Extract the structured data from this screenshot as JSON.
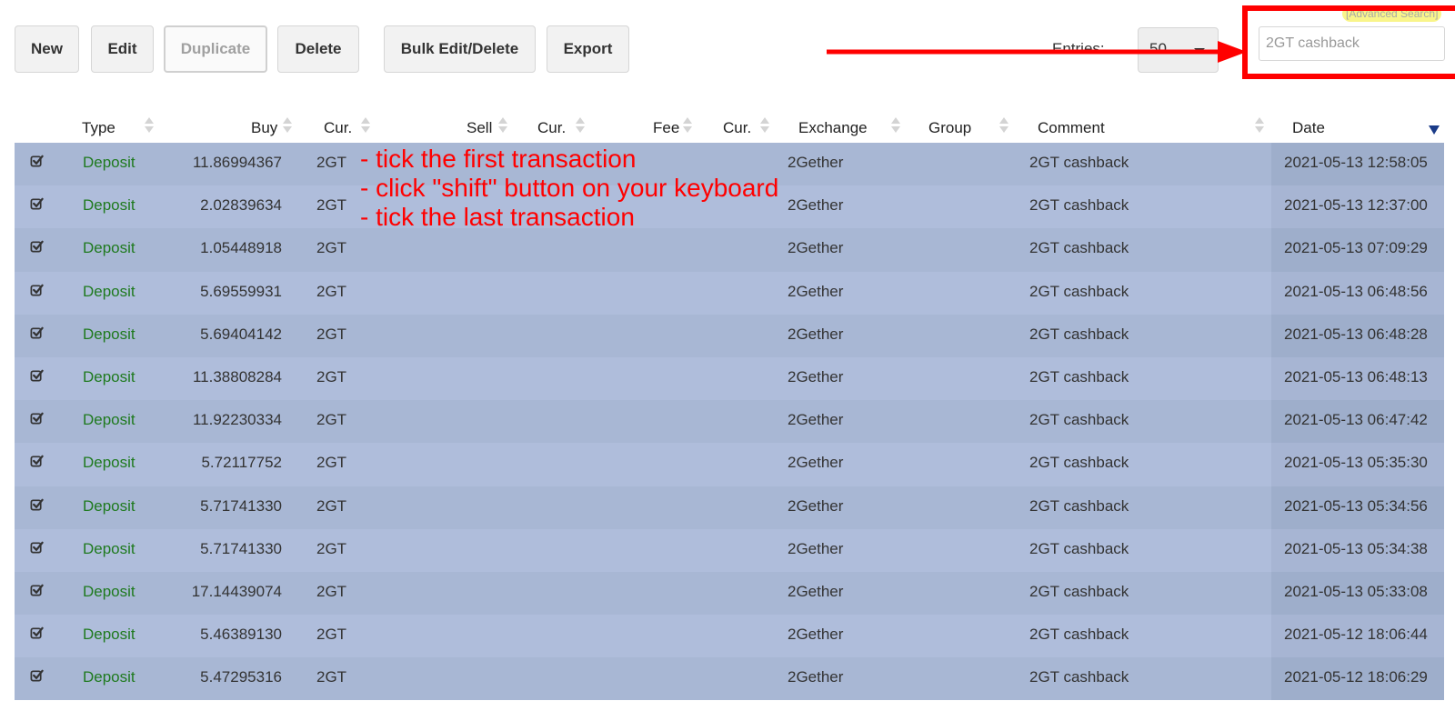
{
  "toolbar": {
    "new_label": "New",
    "edit_label": "Edit",
    "duplicate_label": "Duplicate",
    "delete_label": "Delete",
    "bulk_label": "Bulk Edit/Delete",
    "export_label": "Export",
    "entries_label": "Entries:",
    "entries_value": "50",
    "advanced_search": "[Advanced Search]",
    "search_placeholder": "2GT cashback"
  },
  "columns": {
    "type": "Type",
    "buy": "Buy",
    "buy_cur": "Cur.",
    "sell": "Sell",
    "sell_cur": "Cur.",
    "fee": "Fee",
    "fee_cur": "Cur.",
    "exchange": "Exchange",
    "group": "Group",
    "comment": "Comment",
    "date": "Date"
  },
  "rows": [
    {
      "type": "Deposit",
      "buy": "11.86994367",
      "cur": "2GT",
      "exchange": "2Gether",
      "comment": "2GT cashback",
      "date": "2021-05-13 12:58:05"
    },
    {
      "type": "Deposit",
      "buy": "2.02839634",
      "cur": "2GT",
      "exchange": "2Gether",
      "comment": "2GT cashback",
      "date": "2021-05-13 12:37:00"
    },
    {
      "type": "Deposit",
      "buy": "1.05448918",
      "cur": "2GT",
      "exchange": "2Gether",
      "comment": "2GT cashback",
      "date": "2021-05-13 07:09:29"
    },
    {
      "type": "Deposit",
      "buy": "5.69559931",
      "cur": "2GT",
      "exchange": "2Gether",
      "comment": "2GT cashback",
      "date": "2021-05-13 06:48:56"
    },
    {
      "type": "Deposit",
      "buy": "5.69404142",
      "cur": "2GT",
      "exchange": "2Gether",
      "comment": "2GT cashback",
      "date": "2021-05-13 06:48:28"
    },
    {
      "type": "Deposit",
      "buy": "11.38808284",
      "cur": "2GT",
      "exchange": "2Gether",
      "comment": "2GT cashback",
      "date": "2021-05-13 06:48:13"
    },
    {
      "type": "Deposit",
      "buy": "11.92230334",
      "cur": "2GT",
      "exchange": "2Gether",
      "comment": "2GT cashback",
      "date": "2021-05-13 06:47:42"
    },
    {
      "type": "Deposit",
      "buy": "5.72117752",
      "cur": "2GT",
      "exchange": "2Gether",
      "comment": "2GT cashback",
      "date": "2021-05-13 05:35:30"
    },
    {
      "type": "Deposit",
      "buy": "5.71741330",
      "cur": "2GT",
      "exchange": "2Gether",
      "comment": "2GT cashback",
      "date": "2021-05-13 05:34:56"
    },
    {
      "type": "Deposit",
      "buy": "5.71741330",
      "cur": "2GT",
      "exchange": "2Gether",
      "comment": "2GT cashback",
      "date": "2021-05-13 05:34:38"
    },
    {
      "type": "Deposit",
      "buy": "17.14439074",
      "cur": "2GT",
      "exchange": "2Gether",
      "comment": "2GT cashback",
      "date": "2021-05-13 05:33:08"
    },
    {
      "type": "Deposit",
      "buy": "5.46389130",
      "cur": "2GT",
      "exchange": "2Gether",
      "comment": "2GT cashback",
      "date": "2021-05-12 18:06:44"
    },
    {
      "type": "Deposit",
      "buy": "5.47295316",
      "cur": "2GT",
      "exchange": "2Gether",
      "comment": "2GT cashback",
      "date": "2021-05-12 18:06:29"
    }
  ],
  "annotation": {
    "line1": "- tick the first transaction",
    "line2": "- click \"shift\" button on your keyboard",
    "line3": "- tick the last transaction"
  },
  "colors": {
    "annotation_red": "#ff0000",
    "row_odd": "#a8b7d4",
    "row_even": "#afbddb",
    "type_green": "#1f7a1f",
    "sort_active": "#1a3b88"
  },
  "icons": {
    "row_checkbox": "checked-checkbox-icon",
    "sort": "sort-icon",
    "sort_desc": "sort-desc-icon",
    "dropdown": "chevron-down-icon"
  }
}
